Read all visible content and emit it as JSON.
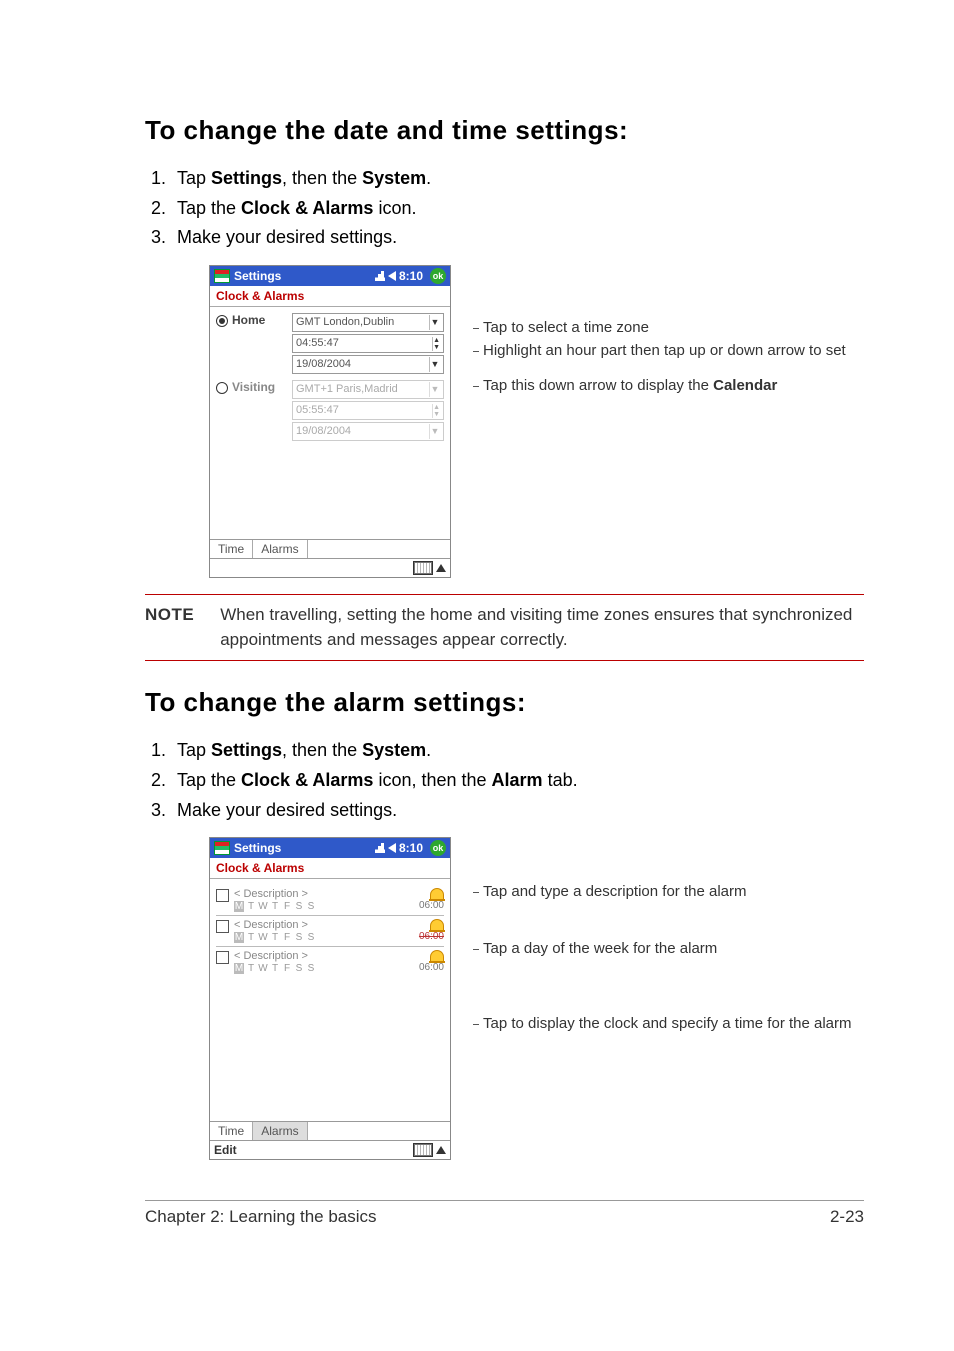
{
  "headings": {
    "h1": "To change the date and time settings:",
    "h2": "To change the alarm settings:"
  },
  "steps1": {
    "s1a": "Tap ",
    "s1b": "Settings",
    "s1c": ", then the ",
    "s1d": "System",
    "s1e": ".",
    "s2a": "Tap the ",
    "s2b": "Clock & Alarms",
    "s2c": " icon.",
    "s3": "Make your desired settings."
  },
  "steps2": {
    "s1a": "Tap ",
    "s1b": "Settings",
    "s1c": ", then the ",
    "s1d": "System",
    "s1e": ".",
    "s2a": "Tap the ",
    "s2b": "Clock & Alarms",
    "s2c": " icon, then the ",
    "s2d": "Alarm",
    "s2e": " tab.",
    "s3": "Make your desired settings."
  },
  "pda_common": {
    "title": "Settings",
    "time": "8:10",
    "ok": "ok",
    "subheader": "Clock & Alarms",
    "tab_time": "Time",
    "tab_alarms": "Alarms"
  },
  "pda_time": {
    "home_label": "Home",
    "visiting_label": "Visiting",
    "home_tz": "GMT London,Dublin",
    "home_time": "04:55:47",
    "home_date": "19/08/2004",
    "visit_tz": "GMT+1 Paris,Madrid",
    "visit_time": "05:55:47",
    "visit_date": "19/08/2004"
  },
  "pda_alarm": {
    "desc": "< Description >",
    "days": [
      "M",
      "T",
      "W",
      "T",
      "F",
      "S",
      "S"
    ],
    "time1": "06:00",
    "time2": "06:00",
    "time3": "06:00",
    "edit": "Edit"
  },
  "callouts1": {
    "c1": "Tap to select a time zone",
    "c2": "Highlight an hour part then tap up or down arrow to set",
    "c3a": "Tap this down arrow to display the ",
    "c3b": "Calendar"
  },
  "callouts2": {
    "c1": "Tap and type a description for the alarm",
    "c2": "Tap a day of the week for the alarm",
    "c3": "Tap to display the clock and specify a time for the alarm"
  },
  "note": {
    "label": "NOTE",
    "text": "When travelling, setting the home and visiting time zones ensures that synchronized appointments and messages appear correctly."
  },
  "footer": {
    "left": "Chapter 2: Learning the basics",
    "right": "2-23"
  }
}
